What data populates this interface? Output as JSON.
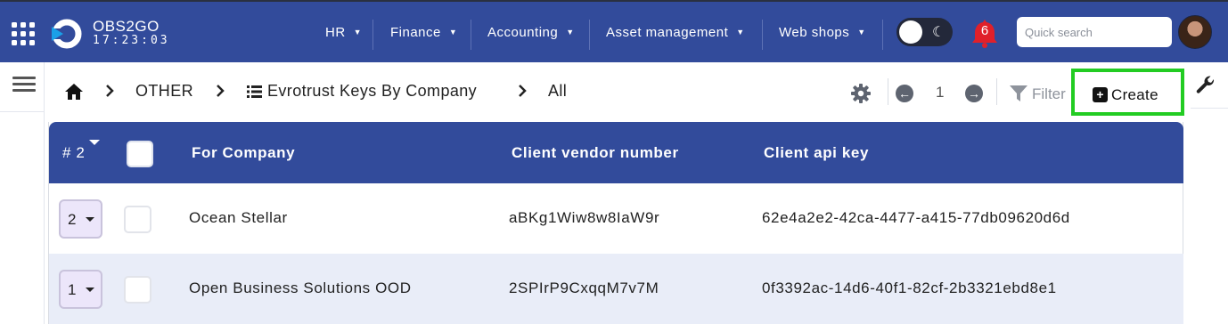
{
  "app": {
    "brand": "OBS2GO",
    "clock": "17:23:03",
    "notifications_count": "6",
    "search_placeholder": "Quick search"
  },
  "nav": [
    {
      "label": "HR"
    },
    {
      "label": "Finance"
    },
    {
      "label": "Accounting"
    },
    {
      "label": "Asset management"
    },
    {
      "label": "Web shops"
    }
  ],
  "breadcrumb": {
    "section": "OTHER",
    "module": "Evrotrust Keys By Company",
    "view": "All"
  },
  "toolbar": {
    "page": "1",
    "filter_label": "Filter",
    "create_label": "Create"
  },
  "table": {
    "columns": {
      "num": "# 2",
      "company": "For Company",
      "vendor": "Client vendor number",
      "apikey": "Client api key"
    },
    "rows": [
      {
        "num": "2",
        "company": "Ocean Stellar",
        "vendor": "aBKg1Wiw8w8IaW9r",
        "apikey": "62e4a2e2-42ca-4477-a415-77db09620d6d"
      },
      {
        "num": "1",
        "company": "Open Business Solutions OOD",
        "vendor": "2SPIrP9CxqqM7v7M",
        "apikey": "0f3392ac-14d6-40f1-82cf-2b3321ebd8e1"
      }
    ]
  },
  "colors": {
    "nav_bg": "#324b9b",
    "create_highlight": "#22cc22",
    "badge_red": "#e0202a"
  }
}
